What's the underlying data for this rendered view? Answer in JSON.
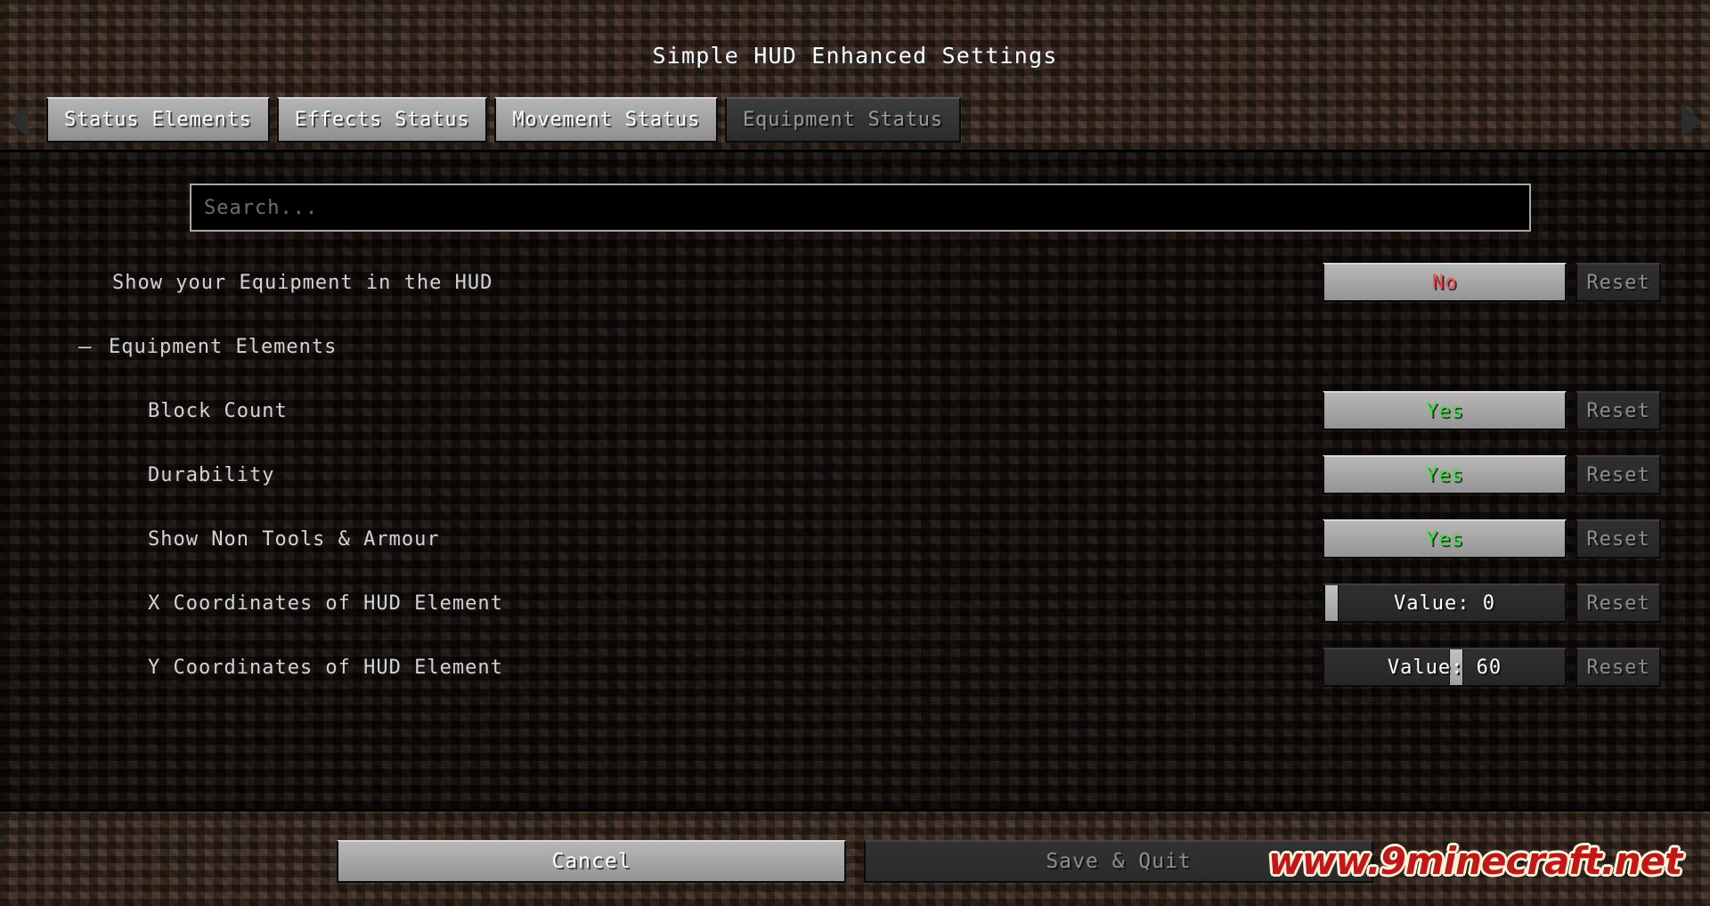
{
  "window": {
    "title": "Simple HUD Enhanced Settings"
  },
  "nav": {
    "left_arrow_icon": "chevron-left-icon",
    "right_arrow_icon": "chevron-right-icon"
  },
  "tabs": [
    {
      "label": "Status Elements",
      "active": false
    },
    {
      "label": "Effects Status",
      "active": false
    },
    {
      "label": "Movement Status",
      "active": false
    },
    {
      "label": "Equipment Status",
      "active": true
    }
  ],
  "search": {
    "placeholder": "Search...",
    "value": ""
  },
  "rows": [
    {
      "label": "Show your Equipment in the HUD",
      "indent": "top",
      "control": "toggle",
      "value": "No",
      "value_state": "no",
      "reset_label": "Reset"
    },
    {
      "label": "Equipment Elements",
      "indent": "category",
      "control": "category",
      "collapse_sign": "–"
    },
    {
      "label": "Block Count",
      "indent": "child",
      "control": "toggle",
      "value": "Yes",
      "value_state": "yes",
      "reset_label": "Reset"
    },
    {
      "label": "Durability",
      "indent": "child",
      "control": "toggle",
      "value": "Yes",
      "value_state": "yes",
      "reset_label": "Reset"
    },
    {
      "label": "Show Non Tools & Armour",
      "indent": "child",
      "control": "toggle",
      "value": "Yes",
      "value_state": "yes",
      "reset_label": "Reset"
    },
    {
      "label": "X Coordinates of HUD Element",
      "indent": "child",
      "control": "slider",
      "value": "Value: 0",
      "slider_percent": 0,
      "reset_label": "Reset"
    },
    {
      "label": "Y Coordinates of HUD Element",
      "indent": "child",
      "control": "slider",
      "value": "Value: 60",
      "slider_percent": 55,
      "reset_label": "Reset"
    }
  ],
  "footer": {
    "cancel_label": "Cancel",
    "save_label": "Save & Quit",
    "watermark": "www.9minecraft.net"
  },
  "colors": {
    "yes": "#37e338",
    "no": "#ff4d4d",
    "watermark_red": "#c31616",
    "watermark_outline": "#fdf6dc"
  }
}
